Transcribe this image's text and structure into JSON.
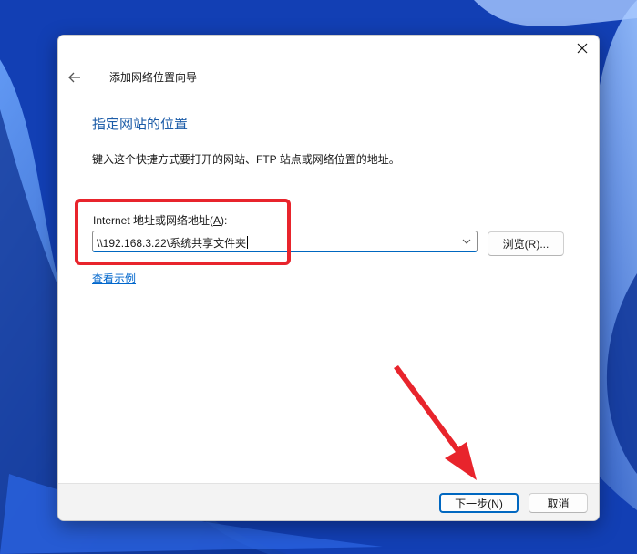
{
  "dialog": {
    "wizard_title": "添加网络位置向导",
    "page_heading": "指定网站的位置",
    "description": "键入这个快捷方式要打开的网站、FTP 站点或网络位置的地址。",
    "address": {
      "label_prefix": "Internet 地址或网络地址(",
      "label_accel": "A",
      "label_suffix": "):",
      "value": "\\\\192.168.3.22\\系统共享文件夹"
    },
    "browse_button": "浏览(R)...",
    "example_link": "查看示例",
    "next_button": "下一步(N)",
    "cancel_button": "取消"
  },
  "annotations": {
    "highlight_color": "#e8242c"
  },
  "colors": {
    "heading": "#1c5ca8",
    "link": "#0066cc",
    "accent": "#0067c0"
  },
  "icons": [
    "close-icon",
    "back-arrow-icon",
    "chevron-down-icon",
    "red-arrow-annotation"
  ]
}
